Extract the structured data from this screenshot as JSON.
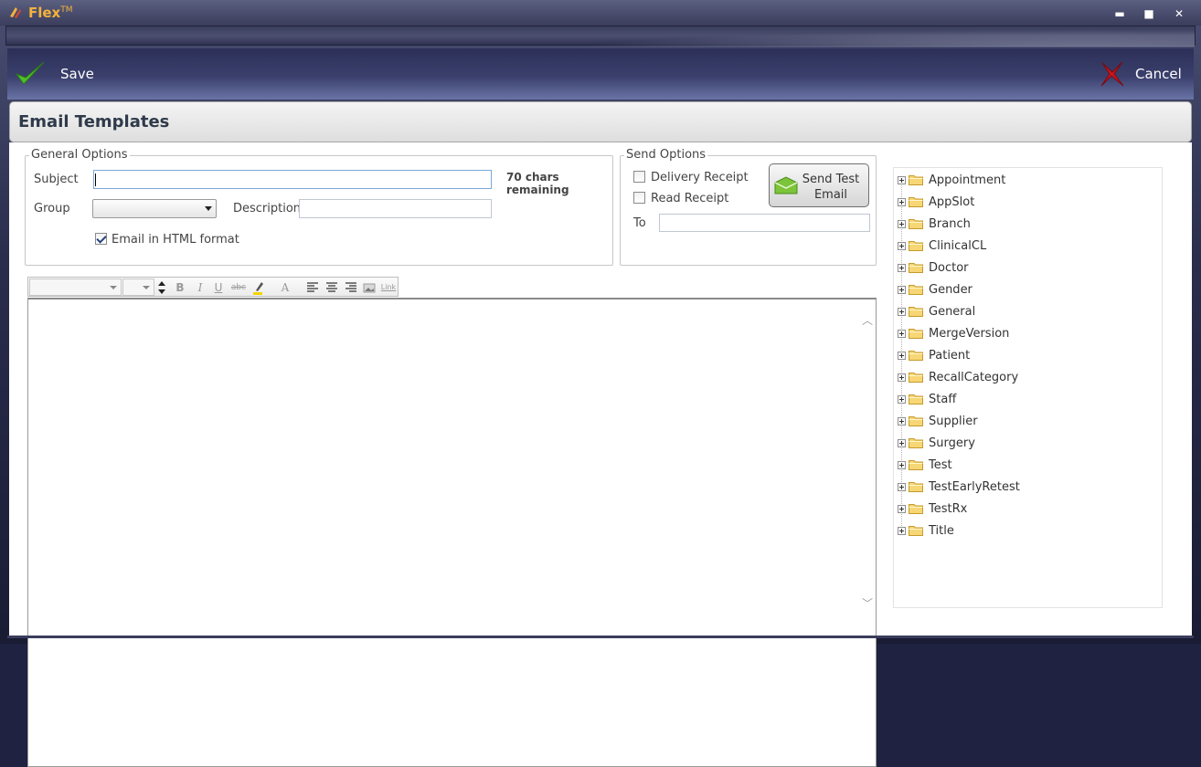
{
  "app": {
    "title": "Flex",
    "trademark": "TM"
  },
  "window_controls": {
    "minimize": "▬",
    "maximize": "■",
    "close": "✕"
  },
  "toolbar": {
    "save_label": "Save",
    "cancel_label": "Cancel"
  },
  "header": {
    "title": "Email Templates"
  },
  "general_options": {
    "legend": "General Options",
    "subject_label": "Subject",
    "subject_value": "",
    "chars_remaining": "70 chars remaining",
    "group_label": "Group",
    "group_value": "",
    "description_label": "Description",
    "description_value": "",
    "html_format_label": "Email in HTML format",
    "html_format_checked": true
  },
  "send_options": {
    "legend": "Send Options",
    "delivery_receipt_label": "Delivery Receipt",
    "read_receipt_label": "Read Receipt",
    "send_test_label": "Send Test Email",
    "to_label": "To",
    "to_value": ""
  },
  "editor_toolbar": {
    "bold": "B",
    "italic": "I",
    "underline": "U",
    "strike": "abc",
    "font_color": "A",
    "link": "Link"
  },
  "tree": {
    "items": [
      "Appointment",
      "AppSlot",
      "Branch",
      "ClinicalCL",
      "Doctor",
      "Gender",
      "General",
      "MergeVersion",
      "Patient",
      "RecallCategory",
      "Staff",
      "Supplier",
      "Surgery",
      "Test",
      "TestEarlyRetest",
      "TestRx",
      "Title"
    ]
  },
  "colors": {
    "accent_title": "#f4b23a",
    "toolbar_dark": "#2c3058",
    "save_check": "#4fbf2a",
    "cancel_x": "#d0141c"
  }
}
